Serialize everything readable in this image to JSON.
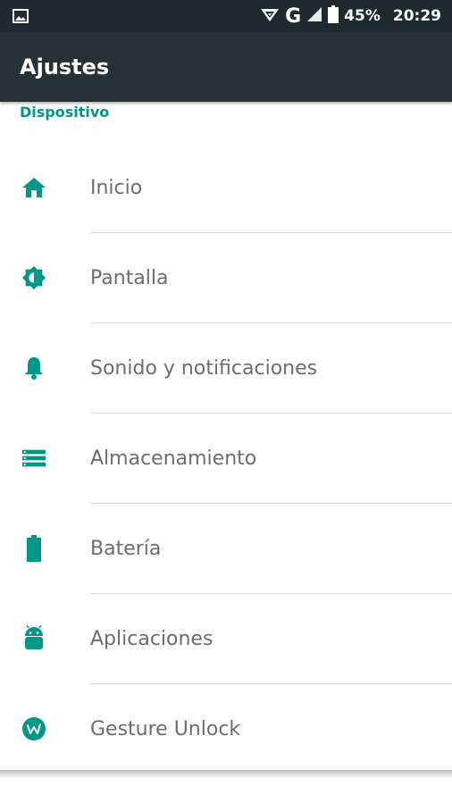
{
  "status_bar": {
    "network": "G",
    "battery_percent": "45%",
    "time": "20:29",
    "icons": [
      "image-icon",
      "signal-icon",
      "battery-icon"
    ]
  },
  "toolbar": {
    "title": "Ajustes"
  },
  "section": {
    "title": "Dispositivo"
  },
  "items": [
    {
      "label": "Inicio",
      "icon": "home-icon"
    },
    {
      "label": "Pantalla",
      "icon": "brightness-icon"
    },
    {
      "label": "Sonido y notificaciones",
      "icon": "bell-icon"
    },
    {
      "label": "Almacenamiento",
      "icon": "storage-icon"
    },
    {
      "label": "Batería",
      "icon": "battery-icon"
    },
    {
      "label": "Aplicaciones",
      "icon": "android-icon"
    },
    {
      "label": "Gesture Unlock",
      "icon": "gesture-unlock-icon"
    }
  ],
  "colors": {
    "accent": "#009688",
    "toolbar": "#263238",
    "status_bar": "#1f2a2e",
    "text": "#6d6d6d"
  }
}
